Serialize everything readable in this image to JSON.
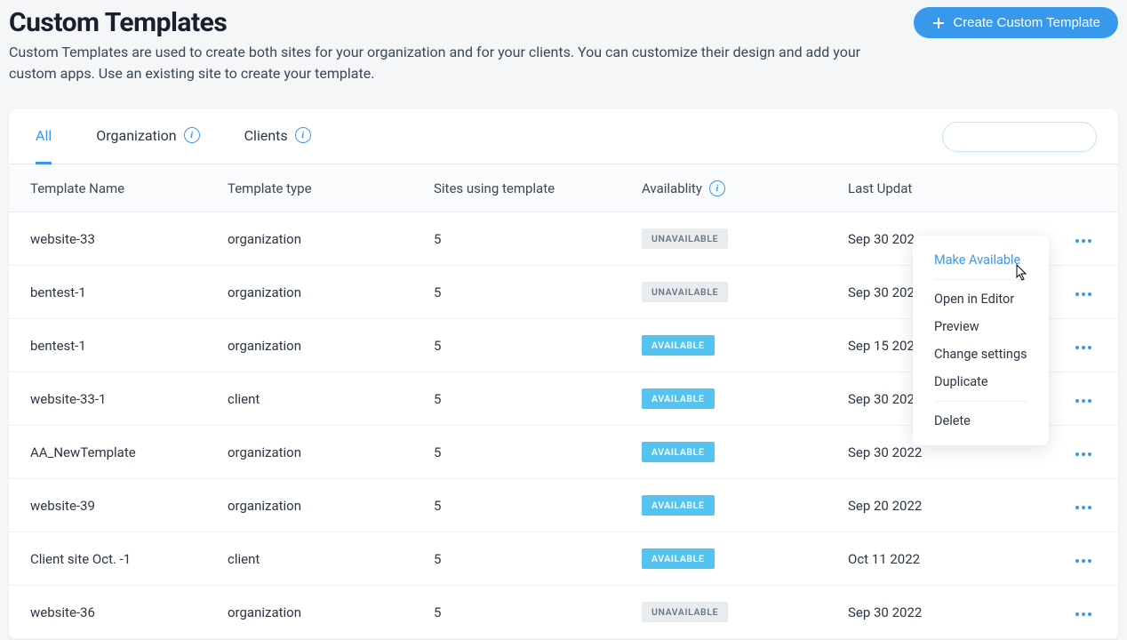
{
  "header": {
    "title": "Custom Templates",
    "create_button": "Create Custom Template",
    "description": "Custom Templates are used to create both sites for your organization and for your clients. You can customize their design and add your custom apps. Use an existing site to create your template."
  },
  "tabs": [
    {
      "label": "All",
      "active": true,
      "info": false
    },
    {
      "label": "Organization",
      "active": false,
      "info": true
    },
    {
      "label": "Clients",
      "active": false,
      "info": true
    }
  ],
  "columns": {
    "name": "Template Name",
    "type": "Template type",
    "sites": "Sites using template",
    "availability": "Availablity",
    "updated": "Last Updat"
  },
  "rows": [
    {
      "name": "website-33",
      "type": "organization",
      "sites": "5",
      "availability": "UNAVAILABLE",
      "updated": "Sep 30 202"
    },
    {
      "name": "bentest-1",
      "type": "organization",
      "sites": "5",
      "availability": "UNAVAILABLE",
      "updated": "Sep 30 202"
    },
    {
      "name": "bentest-1",
      "type": "organization",
      "sites": "5",
      "availability": "AVAILABLE",
      "updated": "Sep 15 2022"
    },
    {
      "name": "website-33-1",
      "type": "client",
      "sites": "5",
      "availability": "AVAILABLE",
      "updated": "Sep 30 2022"
    },
    {
      "name": "AA_NewTemplate",
      "type": "organization",
      "sites": "5",
      "availability": "AVAILABLE",
      "updated": "Sep 30 2022"
    },
    {
      "name": "website-39",
      "type": "organization",
      "sites": "5",
      "availability": "AVAILABLE",
      "updated": "Sep 20 2022"
    },
    {
      "name": "Client site Oct. -1",
      "type": "client",
      "sites": "5",
      "availability": "AVAILABLE",
      "updated": "Oct 11 2022"
    },
    {
      "name": "website-36",
      "type": "organization",
      "sites": "5",
      "availability": "UNAVAILABLE",
      "updated": "Sep 30 2022"
    }
  ],
  "dropdown": {
    "make_available": "Make Available",
    "open_editor": "Open in Editor",
    "preview": "Preview",
    "change_settings": "Change settings",
    "duplicate": "Duplicate",
    "delete": "Delete"
  }
}
